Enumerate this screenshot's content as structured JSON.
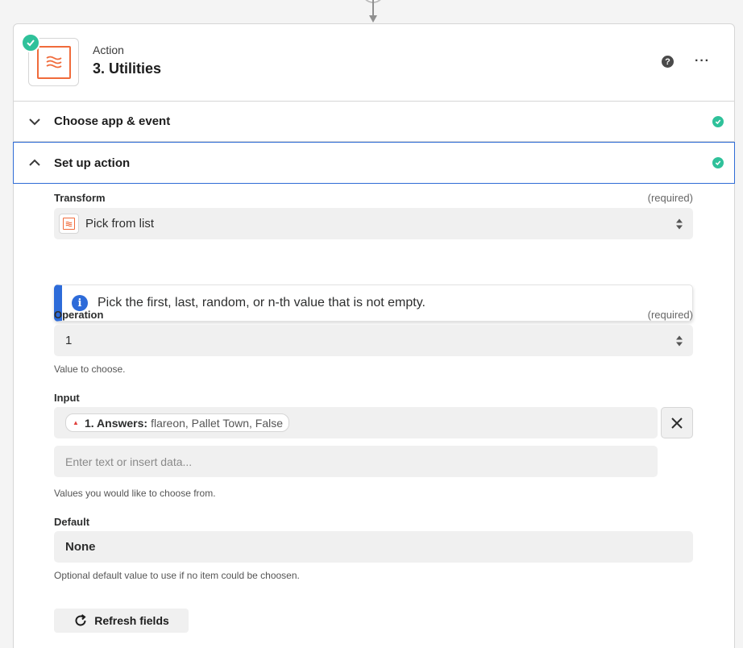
{
  "step": {
    "kind_label": "Action",
    "title": "3. Utilities"
  },
  "header": {
    "help_glyph": "?",
    "more_glyph": "···"
  },
  "sections": [
    {
      "title": "Choose app & event",
      "expanded": false,
      "complete": true
    },
    {
      "title": "Set up action",
      "expanded": true,
      "complete": true
    }
  ],
  "form": {
    "transform": {
      "label": "Transform",
      "required": "(required)",
      "value": "Pick from list"
    },
    "info": {
      "glyph": "i",
      "text": "Pick the first, last, random, or n-th value that is not empty."
    },
    "operation": {
      "label": "Operation",
      "required": "(required)",
      "value": "1",
      "help": "Value to choose."
    },
    "input": {
      "label": "Input",
      "pill_key": "1. Answers:",
      "pill_value": "flareon, Pallet Town, False",
      "placeholder": "Enter text or insert data...",
      "help": "Values you would like to choose from."
    },
    "default": {
      "label": "Default",
      "value": "None",
      "help": "Optional default value to use if no item could be choosen."
    },
    "refresh_label": "Refresh fields"
  },
  "colors": {
    "accent_blue": "#2d6bd9",
    "success_green": "#2fc19a",
    "brand_orange": "#f06b3b"
  }
}
